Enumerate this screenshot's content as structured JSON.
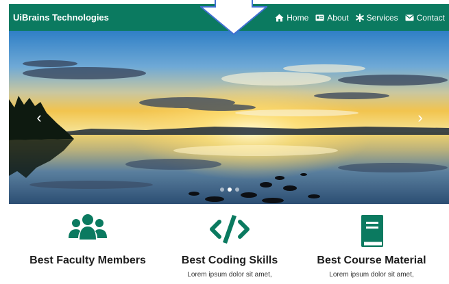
{
  "navbar": {
    "brand": "UiBrains Technologies",
    "items": [
      {
        "label": "Home",
        "icon": "home-icon"
      },
      {
        "label": "About",
        "icon": "id-card-icon"
      },
      {
        "label": "Services",
        "icon": "asterisk-icon"
      },
      {
        "label": "Contact",
        "icon": "envelope-icon"
      }
    ]
  },
  "carousel": {
    "prev_glyph": "‹",
    "next_glyph": "›",
    "slide_count": 3,
    "active_slide": 2
  },
  "features": [
    {
      "title": "Best Faculty Members",
      "text": "",
      "icon": "users-icon"
    },
    {
      "title": "Best Coding Skills",
      "text": "Lorem ipsum dolor sit amet,",
      "icon": "code-icon"
    },
    {
      "title": "Best Course Material",
      "text": "Lorem ipsum dolor sit amet,",
      "icon": "book-icon"
    }
  ],
  "colors": {
    "brand_green": "#0b7a60",
    "arrow_outline": "#3f6fd1"
  }
}
